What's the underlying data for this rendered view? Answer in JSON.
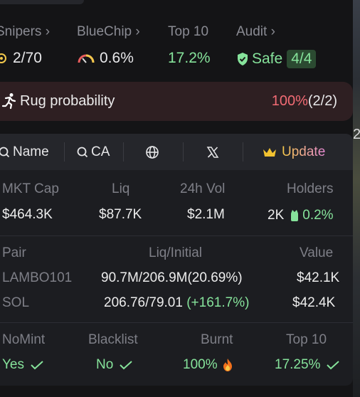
{
  "stats": {
    "snipers": {
      "label": "Snipers",
      "value": "2/70"
    },
    "bluechip": {
      "label": "BlueChip",
      "value": "0.6%"
    },
    "top10": {
      "label": "Top 10",
      "value": "17.2%"
    },
    "audit": {
      "label": "Audit",
      "value": "Safe",
      "badge": "4/4"
    }
  },
  "rug": {
    "label": "Rug probability",
    "percent": "100%",
    "count": "(2/2)"
  },
  "tabs": {
    "name": "Name",
    "ca": "CA",
    "update": "Update"
  },
  "market": {
    "headers": [
      "MKT Cap",
      "Liq",
      "24h Vol",
      "Holders"
    ],
    "values": [
      "$464.3K",
      "$87.7K",
      "$2.1M"
    ],
    "holders_count": "2K",
    "holders_pct": "0.2%"
  },
  "pairs": {
    "headers": [
      "Pair",
      "Liq/Initial",
      "Value"
    ],
    "rows": [
      {
        "pair": "LAMBO101",
        "liq": "90.7M/206.9M(20.69%)",
        "change": "",
        "value": "$42.1K"
      },
      {
        "pair": "SOL",
        "liq": "206.76/79.01",
        "change": "(+161.7%)",
        "value": "$42.4K"
      }
    ]
  },
  "security": {
    "headers": [
      "NoMint",
      "Blacklist",
      "Burnt",
      "Top 10"
    ],
    "values": [
      "Yes",
      "No",
      "100%",
      "17.25%"
    ]
  },
  "right_edge_text": "2",
  "colors": {
    "green": "#86e39b",
    "red": "#f26b74",
    "panel": "#1c1d21"
  }
}
